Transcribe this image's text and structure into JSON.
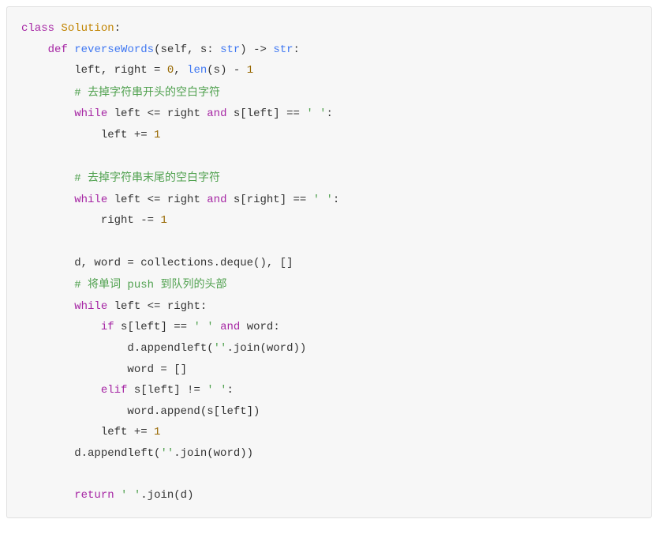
{
  "code": {
    "l01_class": "class",
    "l01_name": "Solution",
    "l01_colon": ":",
    "l02_def": "def",
    "l02_func": "reverseWords",
    "l02_sig_open": "(self, s: ",
    "l02_type": "str",
    "l02_sig_close": ") -> ",
    "l02_ret": "str",
    "l02_colon": ":",
    "l03_vars": "left, right = ",
    "l03_zero": "0",
    "l03_comma": ", ",
    "l03_len": "len",
    "l03_tail": "(s) - ",
    "l03_one": "1",
    "l04_hash": "# ",
    "l04_cn": "去掉字符串开头的空白字符",
    "l05_while": "while",
    "l05_a": " left <= right ",
    "l05_and": "and",
    "l05_b": " s[left] == ",
    "l05_str": "' '",
    "l05_colon": ":",
    "l06_body": "left += ",
    "l06_one": "1",
    "l08_hash": "# ",
    "l08_cn": "去掉字符串末尾的空白字符",
    "l09_while": "while",
    "l09_a": " left <= right ",
    "l09_and": "and",
    "l09_b": " s[right] == ",
    "l09_str": "' '",
    "l09_colon": ":",
    "l10_body": "right -= ",
    "l10_one": "1",
    "l12_a": "d, word = collections.deque(), []",
    "l13_hash": "# ",
    "l13_cn_a": "将单词",
    "l13_push": " push ",
    "l13_cn_b": "到队列的头部",
    "l14_while": "while",
    "l14_cond": " left <= right:",
    "l15_if": "if",
    "l15_a": " s[left] == ",
    "l15_str": "' '",
    "l15_sp": " ",
    "l15_and": "and",
    "l15_b": " word:",
    "l16_body_a": "d.appendleft(",
    "l16_str": "''",
    "l16_body_b": ".join(word))",
    "l17_body": "word = []",
    "l18_elif": "elif",
    "l18_a": " s[left] != ",
    "l18_str": "' '",
    "l18_colon": ":",
    "l19_body": "word.append(s[left])",
    "l20_body": "left += ",
    "l20_one": "1",
    "l21_a": "d.appendleft(",
    "l21_str": "''",
    "l21_b": ".join(word))",
    "l23_return": "return",
    "l23_sp": " ",
    "l23_str": "' '",
    "l23_tail": ".join(d)"
  }
}
